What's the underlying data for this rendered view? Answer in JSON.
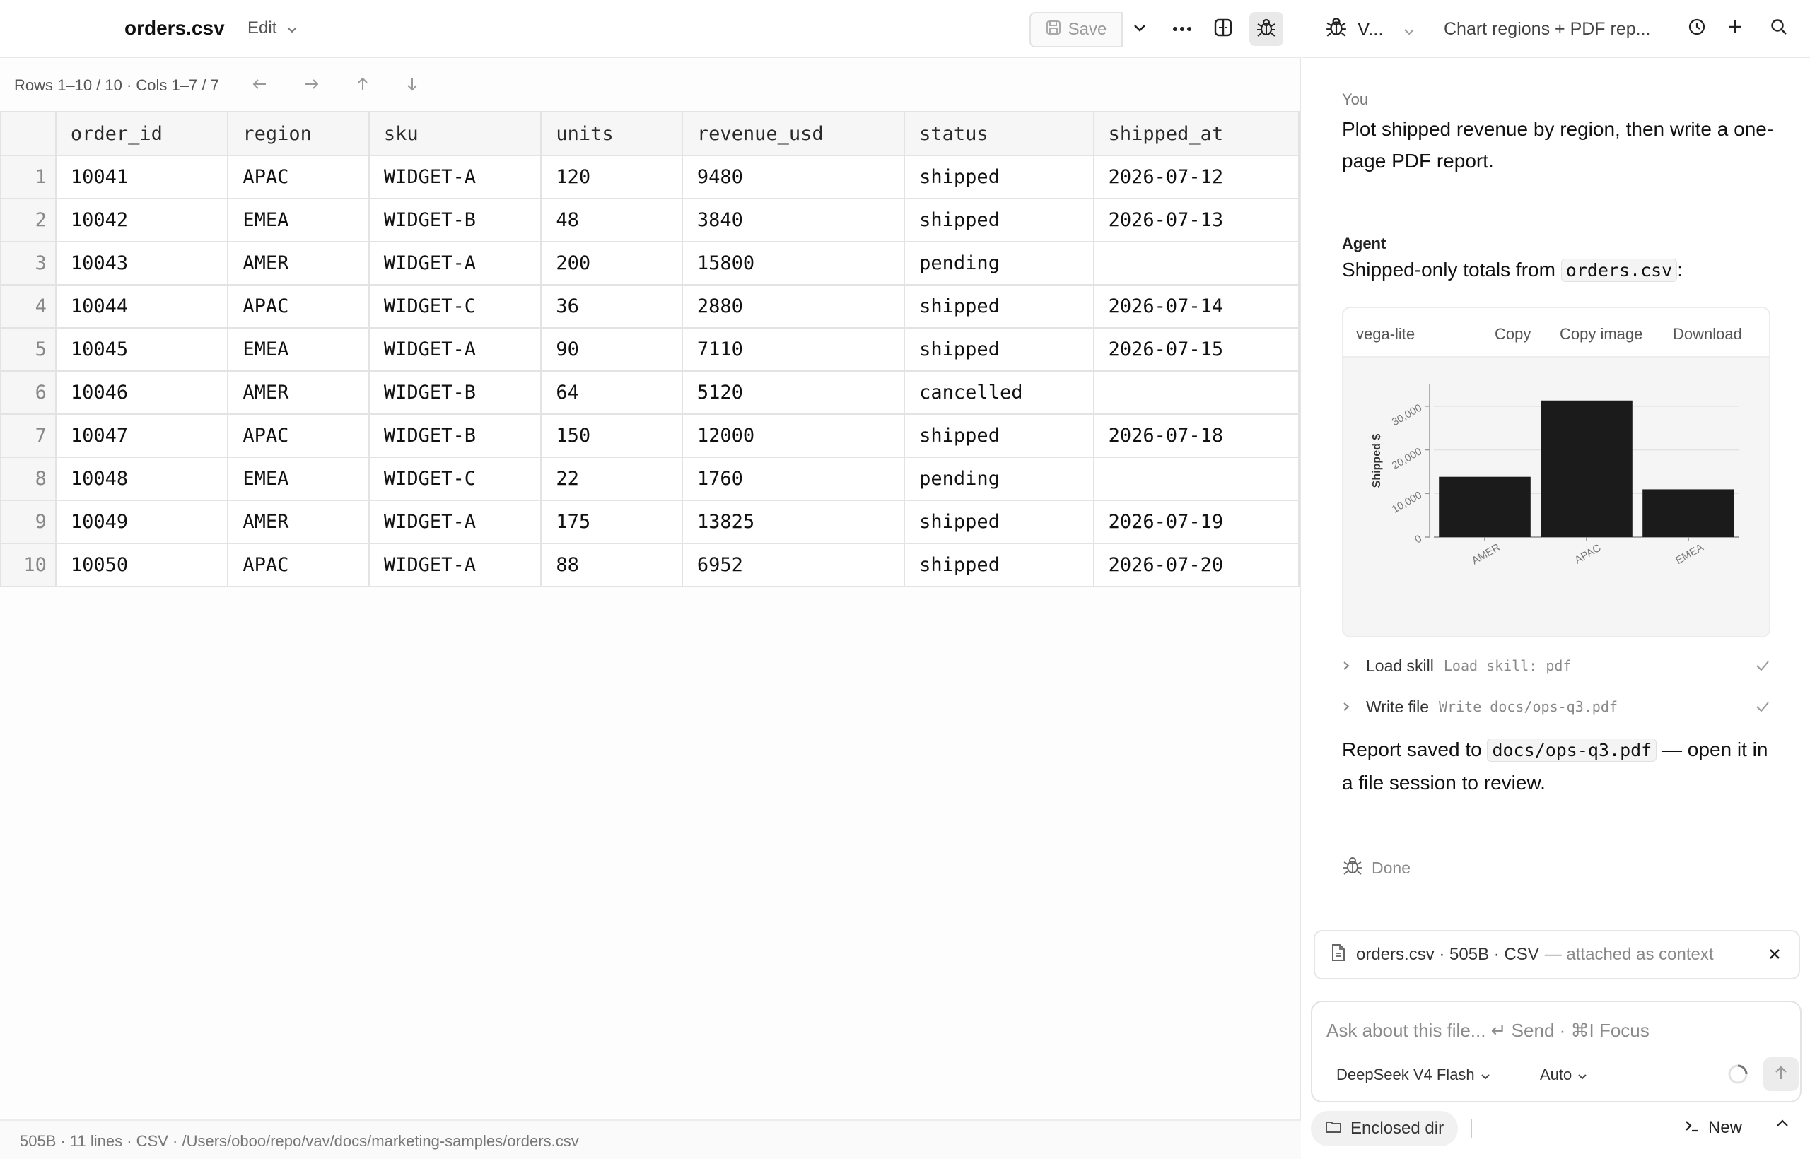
{
  "editor": {
    "file_title": "orders.csv",
    "edit_label": "Edit",
    "save_label": "Save",
    "pager_text": "Rows 1–10 / 10 · Cols 1–7 / 7"
  },
  "table": {
    "columns": [
      "order_id",
      "region",
      "sku",
      "units",
      "revenue_usd",
      "status",
      "shipped_at"
    ],
    "rows": [
      [
        "10041",
        "APAC",
        "WIDGET-A",
        "120",
        "9480",
        "shipped",
        "2026-07-12"
      ],
      [
        "10042",
        "EMEA",
        "WIDGET-B",
        "48",
        "3840",
        "shipped",
        "2026-07-13"
      ],
      [
        "10043",
        "AMER",
        "WIDGET-A",
        "200",
        "15800",
        "pending",
        ""
      ],
      [
        "10044",
        "APAC",
        "WIDGET-C",
        "36",
        "2880",
        "shipped",
        "2026-07-14"
      ],
      [
        "10045",
        "EMEA",
        "WIDGET-A",
        "90",
        "7110",
        "shipped",
        "2026-07-15"
      ],
      [
        "10046",
        "AMER",
        "WIDGET-B",
        "64",
        "5120",
        "cancelled",
        ""
      ],
      [
        "10047",
        "APAC",
        "WIDGET-B",
        "150",
        "12000",
        "shipped",
        "2026-07-18"
      ],
      [
        "10048",
        "EMEA",
        "WIDGET-C",
        "22",
        "1760",
        "pending",
        ""
      ],
      [
        "10049",
        "AMER",
        "WIDGET-A",
        "175",
        "13825",
        "shipped",
        "2026-07-19"
      ],
      [
        "10050",
        "APAC",
        "WIDGET-A",
        "88",
        "6952",
        "shipped",
        "2026-07-20"
      ]
    ]
  },
  "statusbar": {
    "text": "505B · 11 lines · CSV · /Users/oboo/repo/vav/docs/marketing-samples/orders.csv"
  },
  "panel": {
    "agent_label": "V...",
    "session_title": "Chart regions + PDF rep...",
    "you_label": "You",
    "you_message": "Plot shipped revenue by region, then write a one-page PDF report.",
    "agent_name": "Agent",
    "agent_intro": "Shipped-only totals from",
    "agent_intro_code": "orders.csv",
    "agent_intro_suffix": ":",
    "chart_lang": "vega-lite",
    "chart_copy": "Copy",
    "chart_copy_image": "Copy image",
    "chart_download": "Download",
    "tools": [
      {
        "name": "Load skill",
        "detail": "Load skill: pdf"
      },
      {
        "name": "Write file",
        "detail": "Write docs/ops-q3.pdf"
      }
    ],
    "final_pre": "Report saved to",
    "final_code": "docs/ops-q3.pdf",
    "final_post": "— open it in a file session to review.",
    "done_label": "Done",
    "context_file": "orders.csv · 505B · CSV",
    "context_suffix": "— attached as context",
    "composer_placeholder": "Ask about this file... ↵ Send · ⌘I Focus",
    "model": "DeepSeek V4 Flash",
    "mode": "Auto",
    "enclosed_label": "Enclosed dir",
    "new_label": "New"
  },
  "chart_data": {
    "type": "bar",
    "categories": [
      "AMER",
      "APAC",
      "EMEA"
    ],
    "values": [
      13825,
      31312,
      10950
    ],
    "ylabel": "Shipped $",
    "xlabel": "",
    "yticks": [
      0,
      10000,
      20000,
      30000
    ],
    "ytick_labels": [
      "0",
      "10,000",
      "20,000",
      "30,000"
    ],
    "ylim": [
      0,
      35000
    ],
    "bar_color": "#1b1b1b",
    "grid": true
  }
}
